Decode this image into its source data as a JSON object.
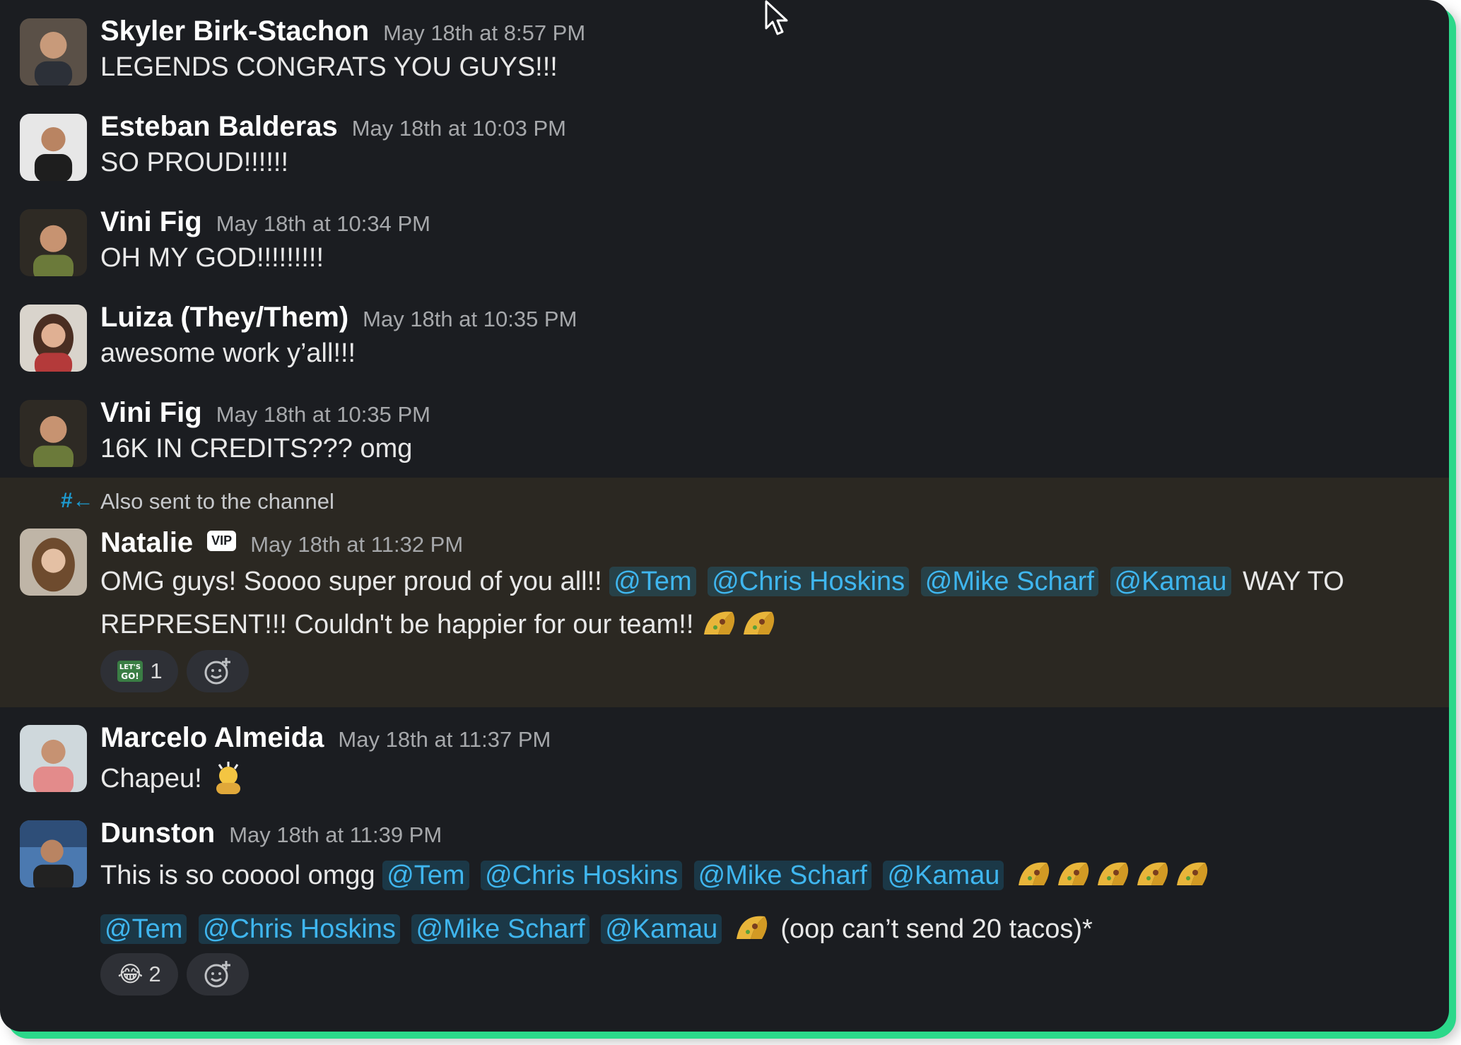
{
  "colors": {
    "background": "#1b1d21",
    "highlight": "#2b2822",
    "mention_text": "#3fb6ef",
    "accent_border": "#2bd88a"
  },
  "messages": [
    {
      "name": "Skyler Birk-Stachon",
      "time": "May 18th at 8:57 PM",
      "text": "LEGENDS CONGRATS YOU GUYS!!!"
    },
    {
      "name": "Esteban Balderas",
      "time": "May 18th at 10:03 PM",
      "text": "SO PROUD!!!!!!"
    },
    {
      "name": "Vini Fig",
      "time": "May 18th at 10:34 PM",
      "text": "OH MY GOD!!!!!!!!!"
    },
    {
      "name": "Luiza (They/Them)",
      "time": "May 18th at 10:35 PM",
      "text": "awesome work y’all!!!"
    },
    {
      "name": "Vini Fig",
      "time": "May 18th at 10:35 PM",
      "text": "16K IN CREDITS??? omg"
    }
  ],
  "natalie": {
    "also_sent": "Also sent to the channel",
    "name": "Natalie",
    "badge": "VIP",
    "time": "May 18th at 11:32 PM",
    "text_before": "OMG guys! Soooo super proud of you all!!",
    "mentions": [
      "@Tem",
      "@Chris Hoskins",
      "@Mike Scharf",
      "@Kamau"
    ],
    "text_after": "WAY TO",
    "line2": "REPRESENT!!! Couldn't be happier for our team!!",
    "reaction_emoji": "lets-go",
    "reaction_count": "1"
  },
  "marcelo": {
    "name": "Marcelo Almeida",
    "time": "May 18th at 11:37 PM",
    "text": "Chapeu!"
  },
  "dunston": {
    "name": "Dunston",
    "time": "May 18th at 11:39 PM",
    "text_before": "This is so cooool omgg",
    "mentions": [
      "@Tem",
      "@Chris Hoskins",
      "@Mike Scharf",
      "@Kamau"
    ],
    "line2_after": "(oop can’t send 20 tacos)*",
    "reaction_emoji": "😂",
    "reaction_count": "2"
  }
}
